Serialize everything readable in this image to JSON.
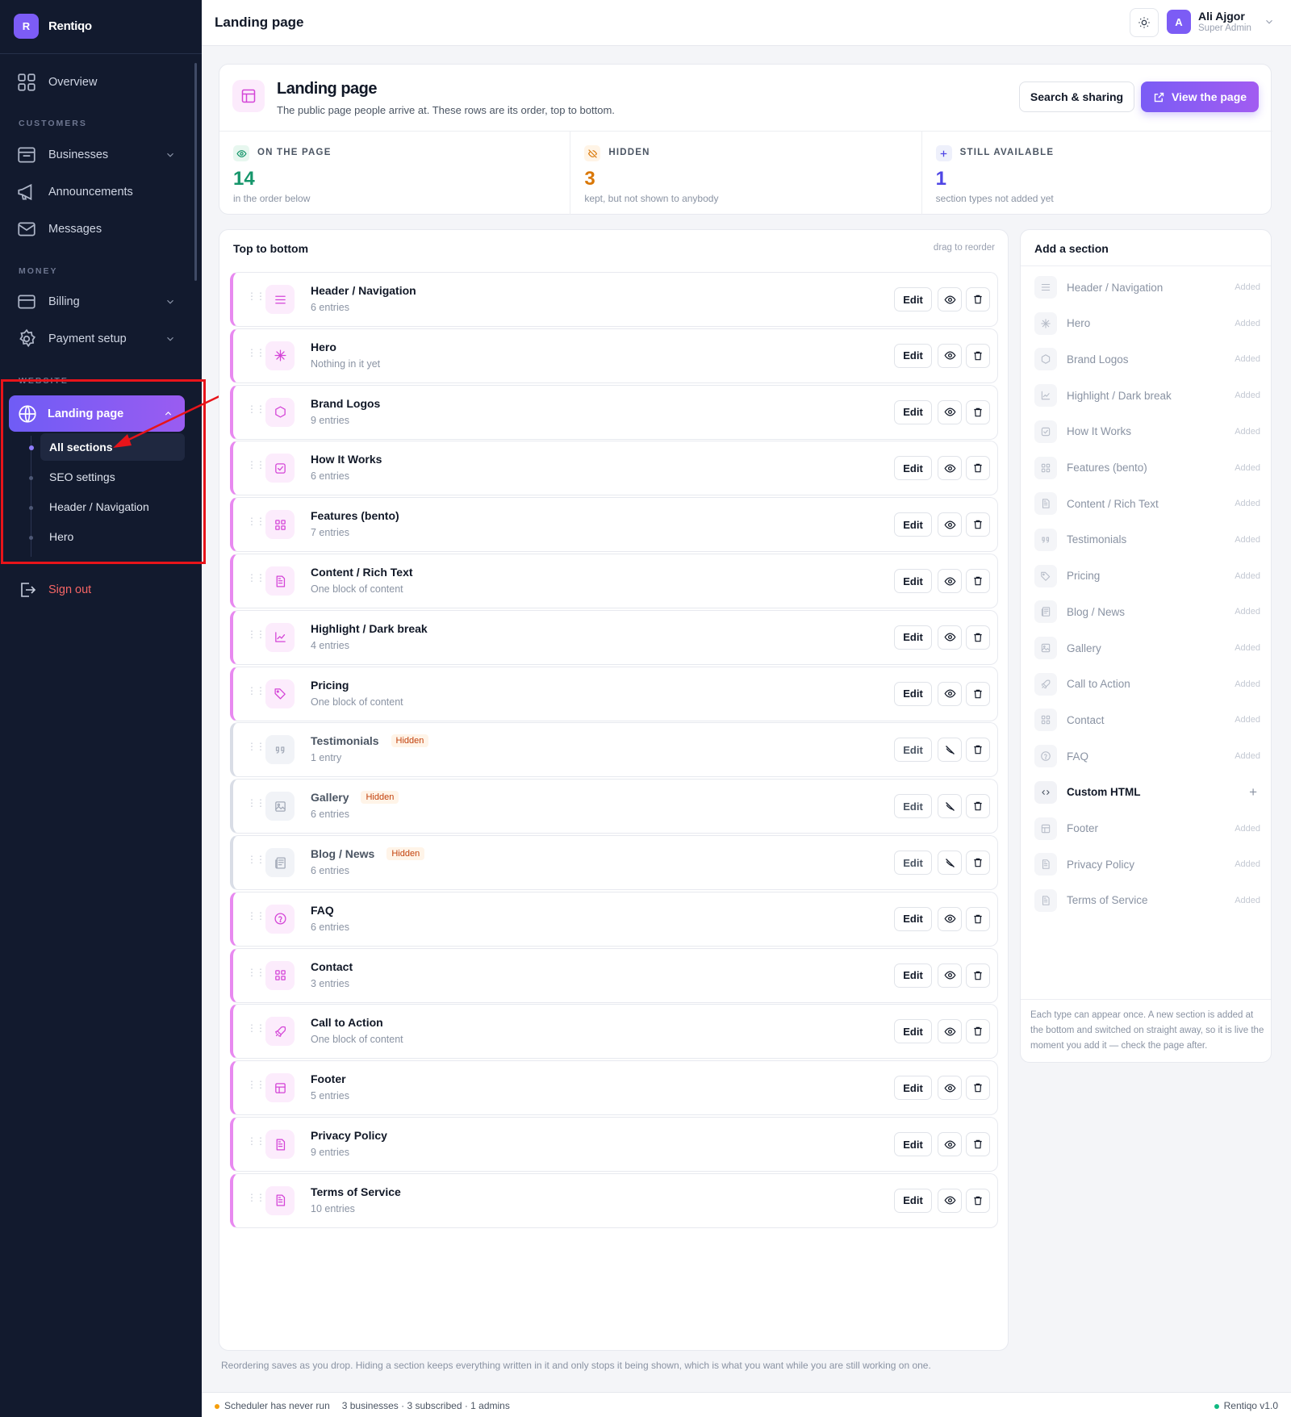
{
  "app": {
    "logo_letter": "R",
    "name": "Rentiqo"
  },
  "sidebar": {
    "overview": "Overview",
    "customers_label": "CUSTOMERS",
    "businesses": "Businesses",
    "announcements": "Announcements",
    "messages": "Messages",
    "money_label": "MONEY",
    "billing": "Billing",
    "payment_setup": "Payment setup",
    "website_label": "WEBSITE",
    "landing_page": "Landing page",
    "sub_items": [
      "All sections",
      "SEO settings",
      "Header / Navigation",
      "Hero"
    ],
    "sign_out": "Sign out"
  },
  "topbar": {
    "title": "Landing page",
    "user_initial": "A",
    "user_name": "Ali Ajgor",
    "user_role": "Super Admin"
  },
  "header": {
    "title": "Landing page",
    "subtitle": "The public page people arrive at. These rows are its order, top to bottom.",
    "search_button": "Search & sharing",
    "view_button": "View the page"
  },
  "stats": [
    {
      "label": "ON THE PAGE",
      "value": "14",
      "note": "in the order below",
      "color": "#16966b",
      "icon": "eye-icon"
    },
    {
      "label": "HIDDEN",
      "value": "3",
      "note": "kept, but not shown to anybody",
      "color": "#d97706",
      "icon": "eye-off-icon"
    },
    {
      "label": "STILL AVAILABLE",
      "value": "1",
      "note": "section types not added yet",
      "color": "#4f46e5",
      "icon": "plus-icon"
    }
  ],
  "list": {
    "title": "Top to bottom",
    "hint": "drag to reorder",
    "edit_label": "Edit",
    "hidden_label": "Hidden",
    "rows": [
      {
        "name": "Header / Navigation",
        "sub": "6 entries",
        "icon": "menu",
        "hidden": false
      },
      {
        "name": "Hero",
        "sub": "Nothing in it yet",
        "icon": "sparkle",
        "hidden": false
      },
      {
        "name": "Brand Logos",
        "sub": "9 entries",
        "icon": "hexagon",
        "hidden": false
      },
      {
        "name": "How It Works",
        "sub": "6 entries",
        "icon": "checkbox",
        "hidden": false
      },
      {
        "name": "Features (bento)",
        "sub": "7 entries",
        "icon": "grid",
        "hidden": false
      },
      {
        "name": "Content / Rich Text",
        "sub": "One block of content",
        "icon": "doc",
        "hidden": false
      },
      {
        "name": "Highlight / Dark break",
        "sub": "4 entries",
        "icon": "chart",
        "hidden": false
      },
      {
        "name": "Pricing",
        "sub": "One block of content",
        "icon": "tag",
        "hidden": false
      },
      {
        "name": "Testimonials",
        "sub": "1 entry",
        "icon": "quote",
        "hidden": true
      },
      {
        "name": "Gallery",
        "sub": "6 entries",
        "icon": "image",
        "hidden": true
      },
      {
        "name": "Blog / News",
        "sub": "6 entries",
        "icon": "news",
        "hidden": true
      },
      {
        "name": "FAQ",
        "sub": "6 entries",
        "icon": "help",
        "hidden": false
      },
      {
        "name": "Contact",
        "sub": "3 entries",
        "icon": "grid",
        "hidden": false
      },
      {
        "name": "Call to Action",
        "sub": "One block of content",
        "icon": "rocket",
        "hidden": false
      },
      {
        "name": "Footer",
        "sub": "5 entries",
        "icon": "layout",
        "hidden": false
      },
      {
        "name": "Privacy Policy",
        "sub": "9 entries",
        "icon": "doc",
        "hidden": false
      },
      {
        "name": "Terms of Service",
        "sub": "10 entries",
        "icon": "doc",
        "hidden": false
      }
    ]
  },
  "add_section": {
    "title": "Add a section",
    "added_label": "Added",
    "items": [
      {
        "name": "Header / Navigation",
        "icon": "menu",
        "available": false
      },
      {
        "name": "Hero",
        "icon": "sparkle",
        "available": false
      },
      {
        "name": "Brand Logos",
        "icon": "hexagon",
        "available": false
      },
      {
        "name": "Highlight / Dark break",
        "icon": "chart",
        "available": false
      },
      {
        "name": "How It Works",
        "icon": "checkbox",
        "available": false
      },
      {
        "name": "Features (bento)",
        "icon": "grid",
        "available": false
      },
      {
        "name": "Content / Rich Text",
        "icon": "doc",
        "available": false
      },
      {
        "name": "Testimonials",
        "icon": "quote",
        "available": false
      },
      {
        "name": "Pricing",
        "icon": "tag",
        "available": false
      },
      {
        "name": "Blog / News",
        "icon": "news",
        "available": false
      },
      {
        "name": "Gallery",
        "icon": "image",
        "available": false
      },
      {
        "name": "Call to Action",
        "icon": "rocket",
        "available": false
      },
      {
        "name": "Contact",
        "icon": "grid",
        "available": false
      },
      {
        "name": "FAQ",
        "icon": "help",
        "available": false
      },
      {
        "name": "Custom HTML",
        "icon": "code",
        "available": true
      },
      {
        "name": "Footer",
        "icon": "layout",
        "available": false
      },
      {
        "name": "Privacy Policy",
        "icon": "doc",
        "available": false
      },
      {
        "name": "Terms of Service",
        "icon": "doc",
        "available": false
      }
    ],
    "note": "Each type can appear once. A new section is added at the bottom and switched on straight away, so it is live the moment you add it — check the page after."
  },
  "bottom_note": "Reordering saves as you drop. Hiding a section keeps everything written in it and only stops it being shown, which is what you want while you are still working on one.",
  "statusbar": {
    "scheduler": "Scheduler has never run",
    "counts": "3 businesses · 3 subscribed · 1 admins",
    "version": "Rentiqo v1.0",
    "scheduler_color": "#f59e0b",
    "version_color": "#10b981"
  },
  "colors": {
    "accent": "#7c5cf5",
    "section_pink": "#d444d7",
    "annotation_red": "#e8141a"
  }
}
